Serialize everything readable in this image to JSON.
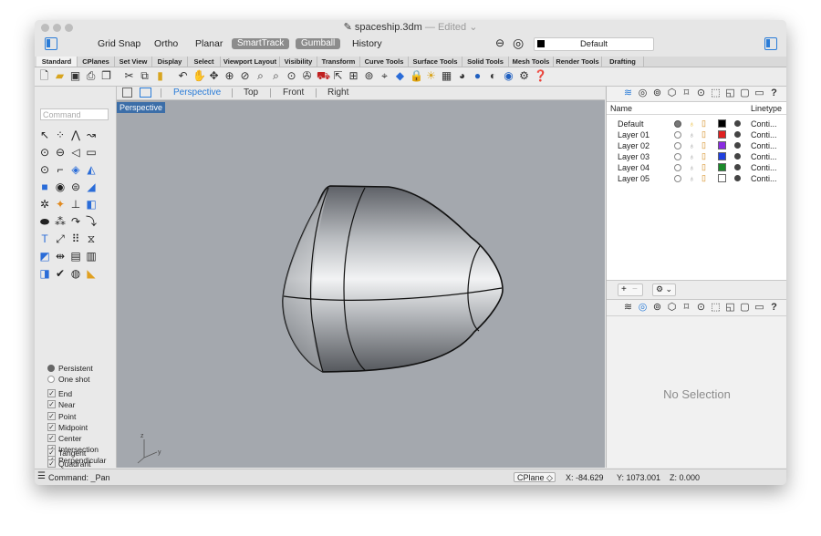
{
  "window": {
    "title": "spaceship.3dm",
    "edited": "— Edited ⌄"
  },
  "toolbar": {
    "buttons": [
      "Grid Snap",
      "Ortho",
      "Planar"
    ],
    "pills": [
      "SmartTrack",
      "Gumball"
    ],
    "history": "History",
    "layer_value": "Default"
  },
  "tabs": [
    "Standard",
    "CPlanes",
    "Set View",
    "Display",
    "Select",
    "Viewport Layout",
    "Visibility",
    "Transform",
    "Curve Tools",
    "Surface Tools",
    "Solid Tools",
    "Mesh Tools",
    "Render Tools",
    "Drafting"
  ],
  "command_placeholder": "Command",
  "viewport_tabs": [
    "Perspective",
    "Top",
    "Front",
    "Right"
  ],
  "viewport_label": "Perspective",
  "osnap_modes": {
    "radios": [
      "Persistent",
      "One shot"
    ],
    "checks": [
      "End",
      "Near",
      "Point",
      "Midpoint",
      "Center",
      "Intersection",
      "Perpendicular",
      "Tangent",
      "Quadrant"
    ]
  },
  "layers": {
    "headers": {
      "name": "Name",
      "linetype": "Linetype"
    },
    "rows": [
      {
        "name": "Default",
        "color": "#000000",
        "linetype": "Conti..."
      },
      {
        "name": "Layer 01",
        "color": "#e02020",
        "linetype": "Conti..."
      },
      {
        "name": "Layer 02",
        "color": "#8a2be2",
        "linetype": "Conti..."
      },
      {
        "name": "Layer 03",
        "color": "#2040e0",
        "linetype": "Conti..."
      },
      {
        "name": "Layer 04",
        "color": "#1a8a2a",
        "linetype": "Conti..."
      },
      {
        "name": "Layer 05",
        "color": "#ffffff",
        "linetype": "Conti..."
      }
    ]
  },
  "properties": {
    "empty": "No Selection"
  },
  "status": {
    "command": "Command: _Pan",
    "cplane": "CPlane ◇",
    "x": "X: -84.629",
    "y": "Y: 1073.001",
    "z": "Z: 0.000"
  }
}
